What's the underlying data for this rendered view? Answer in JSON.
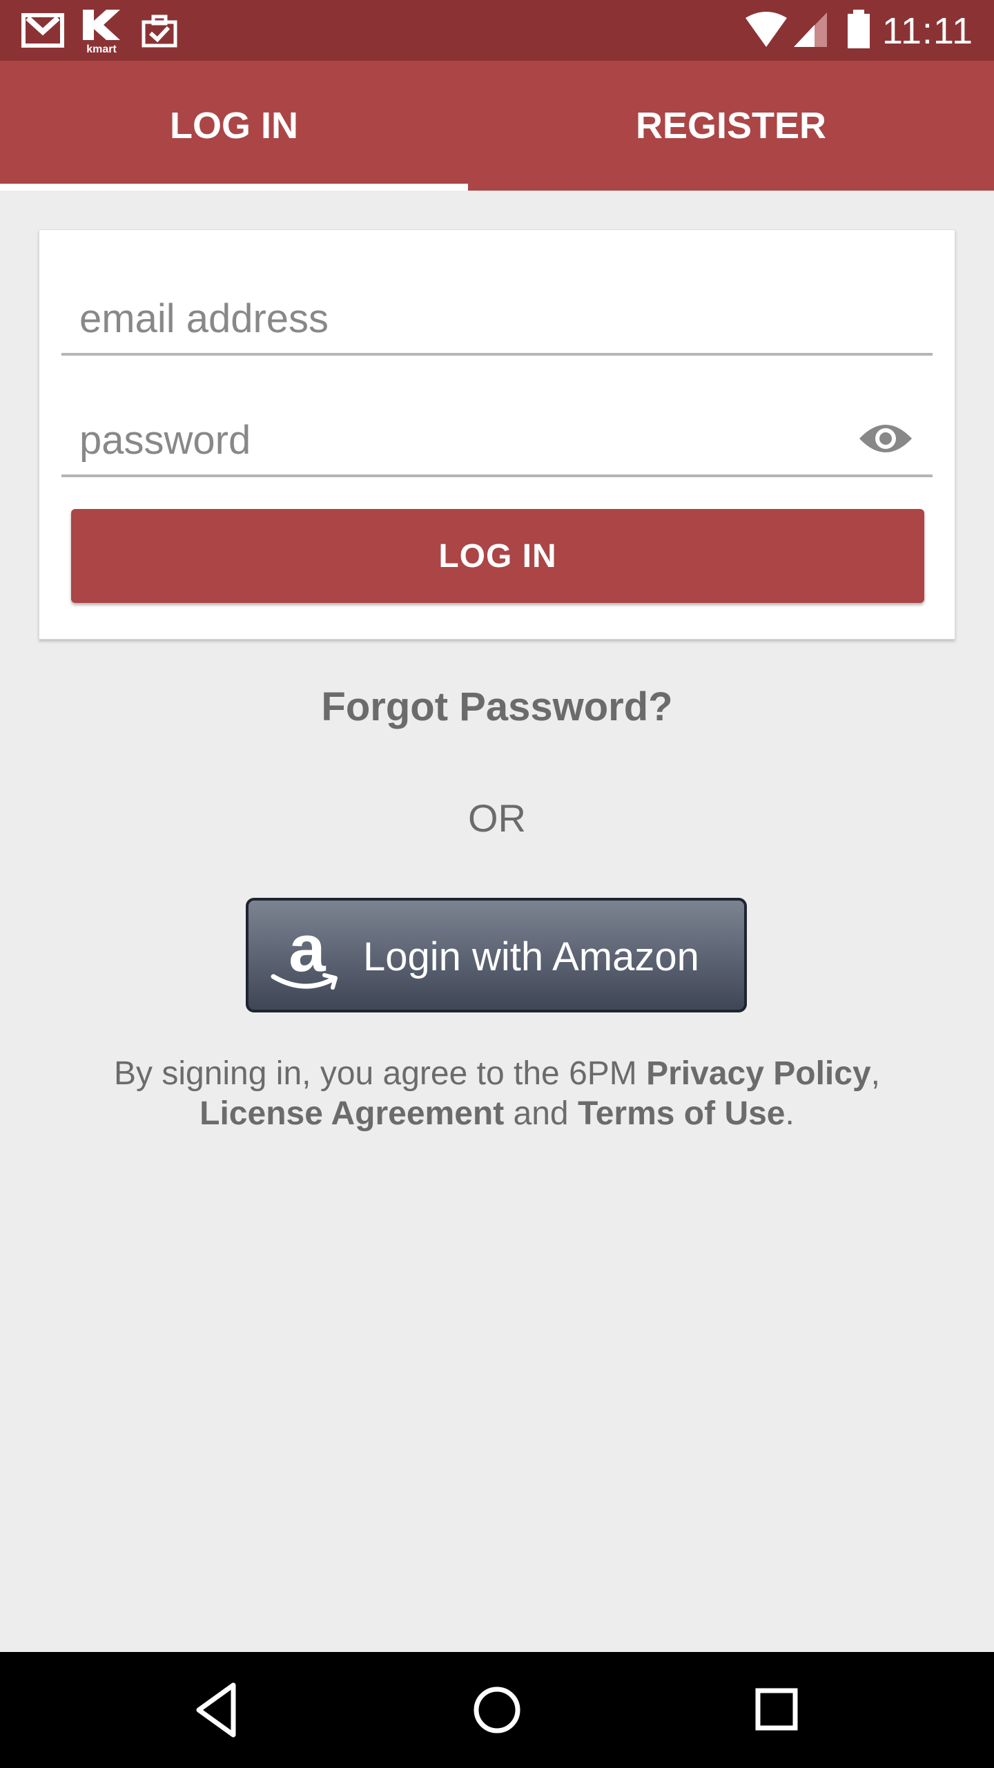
{
  "status_bar": {
    "time": "11:11",
    "icons": [
      "gmail-icon",
      "kmart-icon",
      "task-icon",
      "wifi-icon",
      "signal-icon",
      "battery-icon"
    ],
    "kmart_label": "kmart"
  },
  "tabs": [
    {
      "label": "LOG IN",
      "active": true
    },
    {
      "label": "REGISTER",
      "active": false
    }
  ],
  "login_form": {
    "email_placeholder": "email address",
    "email_value": "",
    "password_placeholder": "password",
    "password_value": "",
    "submit_label": "LOG IN"
  },
  "forgot_password": "Forgot Password?",
  "separator": "OR",
  "amazon_button": {
    "label": "Login with Amazon",
    "logo_letter": "a"
  },
  "legal": {
    "prefix": "By signing in, you agree to the 6PM ",
    "privacy": "Privacy Policy",
    "comma": ",",
    "license": "License Agreement",
    "and": " and ",
    "terms": "Terms of Use",
    "period": "."
  },
  "colors": {
    "status_bar": "#8b3334",
    "accent": "#ab4546",
    "background": "#ededed",
    "text_gray": "#6b6b6b"
  },
  "nav": {
    "buttons": [
      "back-icon",
      "home-icon",
      "recents-icon"
    ]
  }
}
